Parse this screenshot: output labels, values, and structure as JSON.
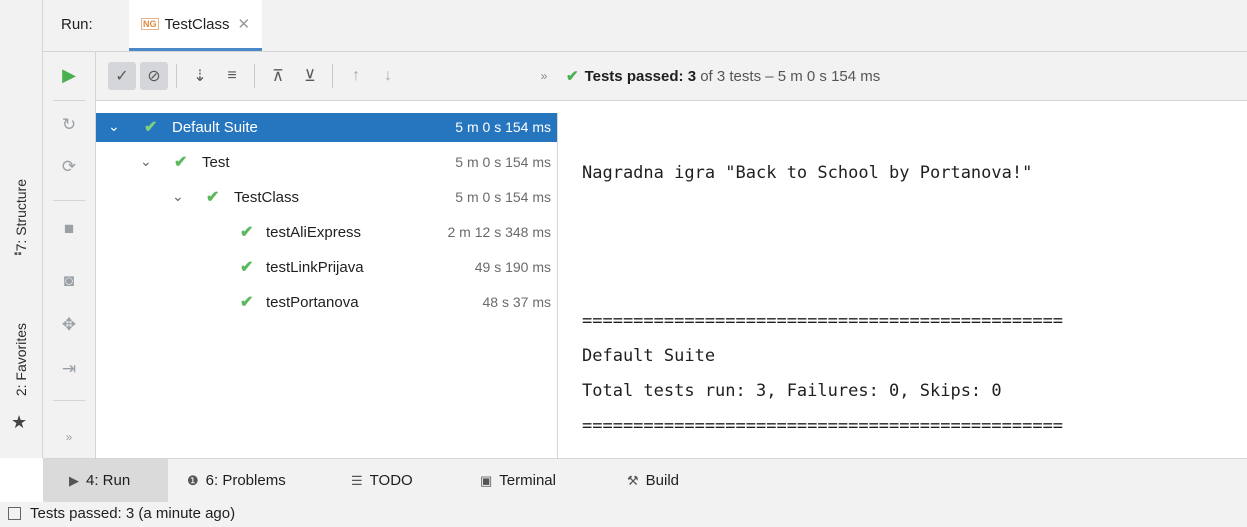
{
  "left_stripe": {
    "structure_label": "7: Structure",
    "favorites_label": "2: Favorites"
  },
  "run_header": {
    "label": "Run:",
    "tab_label": "TestClass",
    "tab_icon": "NG"
  },
  "toolbar": {
    "status_passed": "Tests passed:",
    "status_count": "3",
    "status_rest": "of 3 tests – 5 m 0 s 154 ms"
  },
  "tree": {
    "rows": [
      {
        "name": "Default Suite",
        "time": "5 m 0 s 154 ms"
      },
      {
        "name": "Test",
        "time": "5 m 0 s 154 ms"
      },
      {
        "name": "TestClass",
        "time": "5 m 0 s 154 ms"
      },
      {
        "name": "testAliExpress",
        "time": "2 m 12 s 348 ms"
      },
      {
        "name": "testLinkPrijava",
        "time": "49 s 190 ms"
      },
      {
        "name": "testPortanova",
        "time": "48 s 37 ms"
      }
    ]
  },
  "console": {
    "line1": "Nagradna igra \"Back to School by Portanova!\"",
    "separator": "===============================================",
    "suite": "Default Suite",
    "totals": "Total tests run: 3, Failures: 0, Skips: 0"
  },
  "bottom_tabs": [
    {
      "label": "4: Run"
    },
    {
      "label": "6: Problems"
    },
    {
      "label": "TODO"
    },
    {
      "label": "Terminal"
    },
    {
      "label": "Build"
    }
  ],
  "status_bar": {
    "text": "Tests passed: 3 (a minute ago)"
  },
  "colors": {
    "selection": "#2675bf",
    "pass_green": "#5cb85c",
    "run_green": "#4caf50",
    "panel_bg": "#f2f2f2"
  }
}
